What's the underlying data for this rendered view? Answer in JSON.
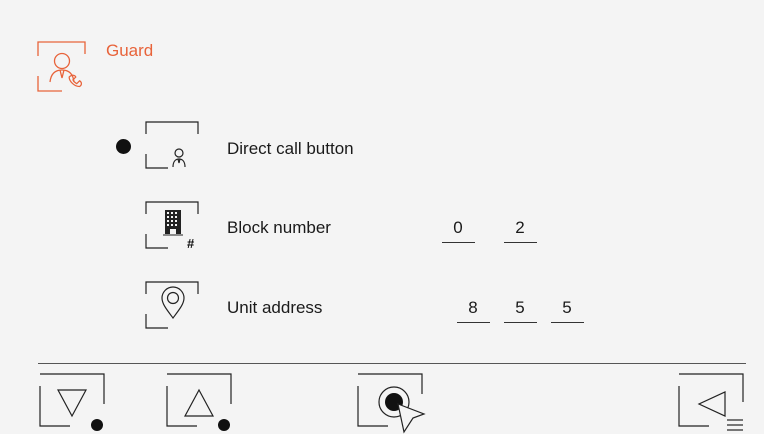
{
  "header": {
    "title": "Guard",
    "icon": "guard-person-phone-icon",
    "accent_color": "#e8633a"
  },
  "rows": [
    {
      "label": "Direct call button",
      "icon": "call-button-person-icon",
      "selected": true,
      "digits": []
    },
    {
      "label": "Block number",
      "icon": "building-hash-icon",
      "selected": false,
      "digits": [
        "0",
        "2"
      ]
    },
    {
      "label": "Unit address",
      "icon": "location-pin-icon",
      "selected": false,
      "digits": [
        "8",
        "5",
        "5"
      ]
    }
  ],
  "footer": {
    "buttons": [
      {
        "name": "down",
        "icon": "triangle-down-icon"
      },
      {
        "name": "up",
        "icon": "triangle-up-icon"
      },
      {
        "name": "select",
        "icon": "select-cursor-icon"
      },
      {
        "name": "back",
        "icon": "back-menu-icon"
      }
    ]
  }
}
